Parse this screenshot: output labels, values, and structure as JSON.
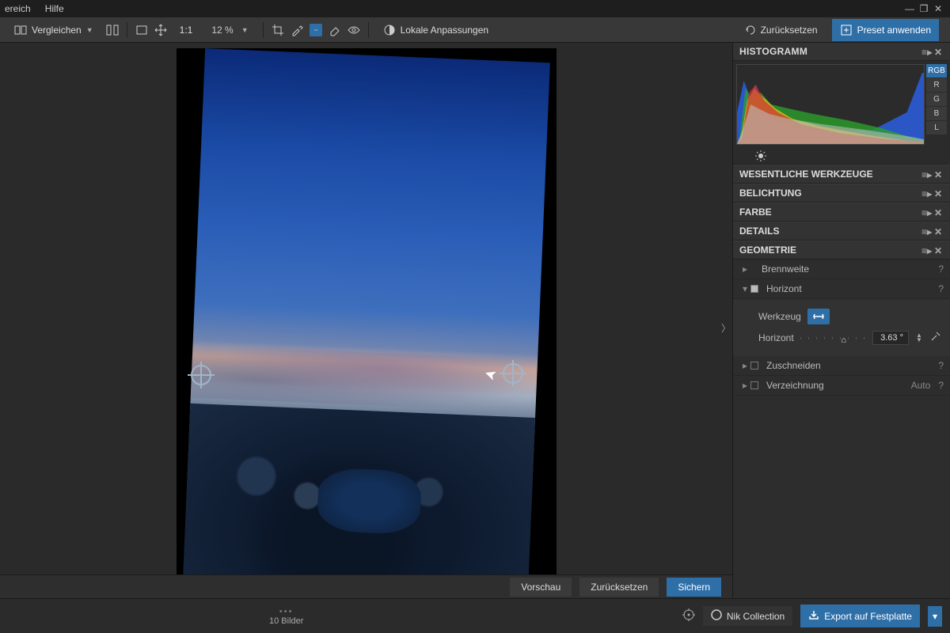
{
  "menubar": {
    "items": [
      "ereich",
      "Hilfe"
    ]
  },
  "window_controls": {
    "min": "—",
    "max": "❐",
    "close": "✕"
  },
  "toolbar": {
    "compare_label": "Vergleichen",
    "zoom_fit": "1:1",
    "zoom_pct": "12 %",
    "local_adjust": "Lokale Anpassungen",
    "reset_label": "Zurücksetzen",
    "preset_label": "Preset anwenden"
  },
  "side": {
    "histogram_title": "HISTOGRAMM",
    "channels": [
      "RGB",
      "R",
      "G",
      "B",
      "L"
    ],
    "active_channel": "RGB",
    "sections": {
      "essential": "WESENTLICHE WERKZEUGE",
      "exposure": "BELICHTUNG",
      "color": "FARBE",
      "details": "DETAILS",
      "geometry": "GEOMETRIE"
    },
    "geometry": {
      "brennweite": "Brennweite",
      "horizont_label": "Horizont",
      "werkzeug_label": "Werkzeug",
      "slider_label": "Horizont",
      "horizont_value": "3.63 °",
      "zuschneiden": "Zuschneiden",
      "verzeichnung": "Verzeichnung",
      "verzeichnung_mode": "Auto"
    }
  },
  "editor_actions": {
    "preview": "Vorschau",
    "reset": "Zurücksetzen",
    "save": "Sichern"
  },
  "statusbar": {
    "count": "10 Bilder",
    "nik": "Nik Collection",
    "export": "Export auf Festplatte"
  },
  "colors": {
    "accent": "#2f6fa8"
  }
}
